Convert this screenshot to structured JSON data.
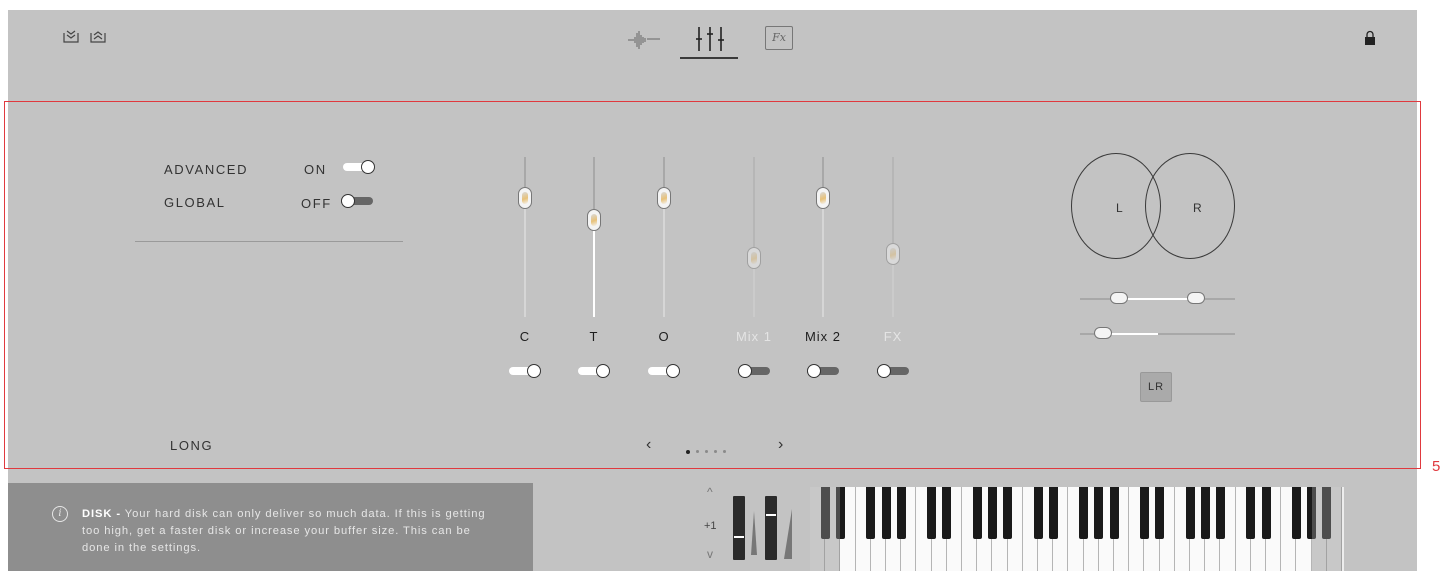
{
  "toolbar": {
    "left_icons": [
      "collapse-down-icon",
      "expand-up-icon"
    ],
    "tabs": [
      {
        "name": "waveform-tab",
        "icon": "waveform-icon",
        "active": false
      },
      {
        "name": "mixer-tab",
        "icon": "mixer-faders-icon",
        "active": true
      },
      {
        "name": "fx-tab",
        "label": "Fx",
        "active": false
      }
    ],
    "lock_icon": "lock-icon"
  },
  "settings": {
    "advanced": {
      "label": "ADVANCED",
      "state_label": "ON",
      "on": true
    },
    "global": {
      "label": "GLOBAL",
      "state_label": "OFF",
      "on": false
    }
  },
  "mixer": {
    "channels": [
      {
        "label": "C",
        "level": 0.78,
        "enabled": true,
        "dim": false
      },
      {
        "label": "T",
        "level": 0.62,
        "enabled": true,
        "dim": false
      },
      {
        "label": "O",
        "level": 0.78,
        "enabled": true,
        "dim": false
      },
      {
        "label": "Mix 1",
        "level": 0.35,
        "enabled": false,
        "dim": true
      },
      {
        "label": "Mix 2",
        "level": 0.78,
        "enabled": false,
        "dim": false
      },
      {
        "label": "FX",
        "level": 0.38,
        "enabled": false,
        "dim": true
      }
    ]
  },
  "stereo": {
    "left_label": "L",
    "right_label": "R",
    "width_range": [
      0.25,
      0.75
    ],
    "pan": 0.15,
    "lr_button": "LR"
  },
  "footer": {
    "mode_label": "LONG",
    "prev_arrow": "‹",
    "next_arrow": "›",
    "page_count": 5,
    "current_page": 1
  },
  "info": {
    "icon": "i",
    "title": "DISK -",
    "text": "Your hard disk can only deliver so much data. If this is getting too high, get a faster disk or increase your buffer size. This can be done in the settings."
  },
  "keyboard_controls": {
    "transpose": "+1",
    "up": "^",
    "down": "v"
  },
  "annotation": {
    "marker": "5",
    "color": "#e0393e"
  }
}
